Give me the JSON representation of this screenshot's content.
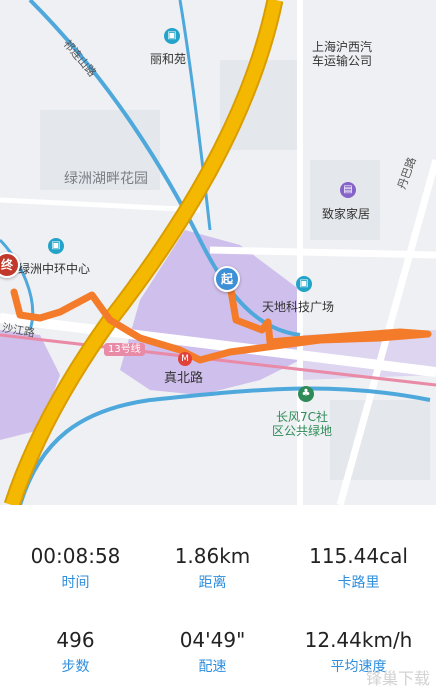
{
  "map": {
    "labels": {
      "lihe": "丽和苑",
      "bus": "上海沪西汽\n车运输公司",
      "lvzhou_garden": "绿洲湖畔花园",
      "zhijia": "致家家居",
      "lvzhou_center": "绿洲中环中心",
      "tiandi": "天地科技广场",
      "zhenbei": "真北路",
      "changfeng": "长风7C社\n区公共绿地",
      "road_qilian": "祁连山路",
      "road_danba": "丹巴路",
      "road_shajiang": "沙江路",
      "line13": "13号线"
    },
    "start_pin": "起",
    "end_pin": "终",
    "colors": {
      "route": "#f47b2a",
      "highway": "#f5b800",
      "river": "#4ea8dc",
      "park": "#c9b6ea",
      "green": "#2e8b57"
    }
  },
  "stats": {
    "time_value": "00:08:58",
    "time_label": "时间",
    "distance_value": "1.86km",
    "distance_label": "距离",
    "calories_value": "115.44cal",
    "calories_label": "卡路里",
    "steps_value": "496",
    "steps_label": "步数",
    "pace_value": "04'49\"",
    "pace_label": "配速",
    "speed_value": "12.44km/h",
    "speed_label": "平均速度"
  },
  "watermark": "锋巢下载"
}
